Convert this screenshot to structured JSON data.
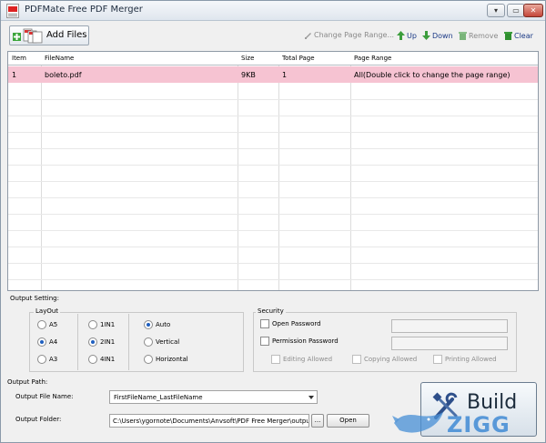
{
  "window": {
    "title": "PDFMate Free PDF Merger",
    "min_glyph": "▾",
    "max_glyph": "▭",
    "close_glyph": "✕"
  },
  "toolbar": {
    "add_files": "Add Files",
    "change_range": "Change Page Range...",
    "up": "Up",
    "down": "Down",
    "remove": "Remove",
    "clear": "Clear"
  },
  "grid": {
    "columns": [
      "Item",
      "FileName",
      "Size",
      "Total Page",
      "Page Range"
    ],
    "rows": [
      [
        "1",
        "boleto.pdf",
        "9KB",
        "1",
        "All(Double click to change the page range)"
      ]
    ]
  },
  "output_setting": {
    "title": "Output Setting:",
    "layout_title": "LayOut",
    "paper": [
      "A5",
      "A4",
      "A3"
    ],
    "pages_per_sheet": [
      "1IN1",
      "2IN1",
      "4IN1"
    ],
    "orientation": [
      "Auto",
      "Vertical",
      "Horizontal"
    ],
    "selected": {
      "paper": "A4",
      "pages_per_sheet": "2IN1",
      "orientation": "Auto"
    },
    "security_title": "Security",
    "open_password": "Open Password",
    "permission_password": "Permission Password",
    "editing": "Editing Allowed",
    "copying": "Copying Allowed",
    "printing": "Printing Allowed"
  },
  "output_path": {
    "title": "Output Path:",
    "file_name_label": "Output File Name:",
    "file_name": "FirstFileName_LastFileName",
    "folder_label": "Output Folder:",
    "folder": "C:\\Users\\ygornote\\Documents\\Anvsoft\\PDF Free Merger\\output\\",
    "browse": "...",
    "open": "Open"
  },
  "build": {
    "label": "Build"
  },
  "watermark": {
    "text": "ZIGG"
  },
  "colors": {
    "selected_row": "#f6c3d2",
    "accent": "#1f5fbf"
  }
}
